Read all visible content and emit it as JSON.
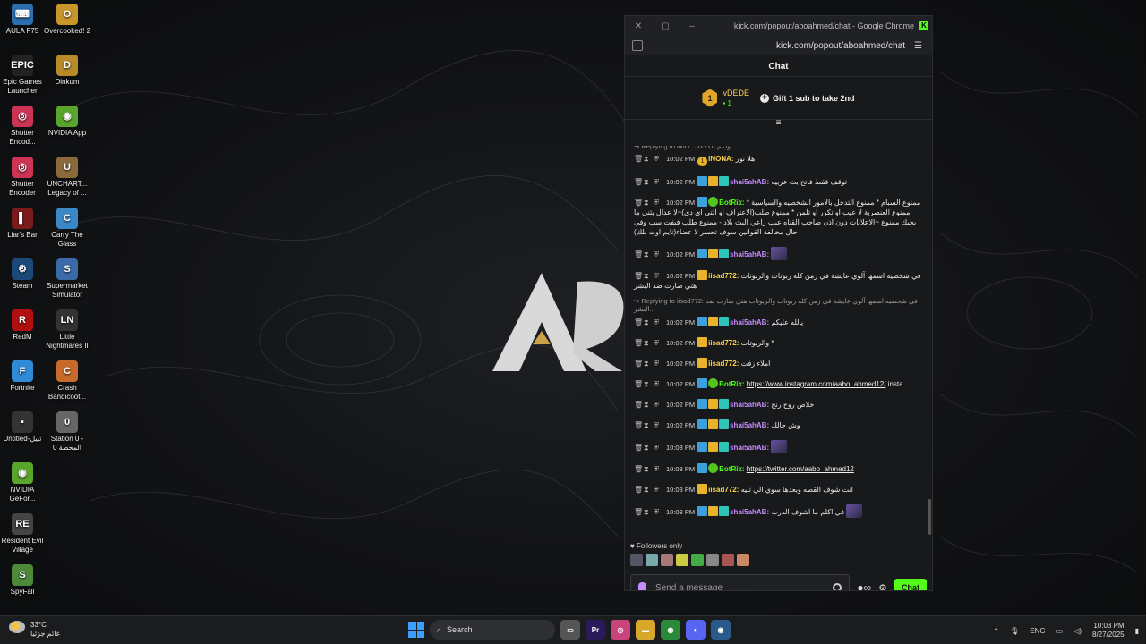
{
  "desktop": {
    "left_column": [
      {
        "label": "AULA F75",
        "color": "#2a6fb0",
        "glyph": "⌨"
      },
      {
        "label": "Epic Games Launcher",
        "color": "#222222",
        "glyph": "EPIC"
      },
      {
        "label": "Shutter Encod...",
        "color": "#cc3355",
        "glyph": "◎"
      },
      {
        "label": "Shutter Encoder",
        "color": "#cc3355",
        "glyph": "◎"
      },
      {
        "label": "Liar's Bar",
        "color": "#7a1a1a",
        "glyph": "▌"
      },
      {
        "label": "Steam",
        "color": "#1b4a7a",
        "glyph": "⚙"
      },
      {
        "label": "RedM",
        "color": "#b01010",
        "glyph": "R"
      },
      {
        "label": "Fortnite",
        "color": "#2f8ad8",
        "glyph": "F"
      },
      {
        "label": "Untitled-تبيل",
        "color": "#333333",
        "glyph": "▪"
      },
      {
        "label": "NVIDIA GeFor...",
        "color": "#5aa62c",
        "glyph": "◉"
      },
      {
        "label": "Resident Evil Village",
        "color": "#444444",
        "glyph": "RE"
      },
      {
        "label": "SpyFall",
        "color": "#4c8a3a",
        "glyph": "S"
      }
    ],
    "right_column": [
      {
        "label": "Overcooked! 2",
        "color": "#c8962a",
        "glyph": "O"
      },
      {
        "label": "Dinkum",
        "color": "#b88a2a",
        "glyph": "D"
      },
      {
        "label": "NVIDIA App",
        "color": "#5aa62c",
        "glyph": "◉"
      },
      {
        "label": "UNCHART... Legacy of ...",
        "color": "#8a6a3a",
        "glyph": "U"
      },
      {
        "label": "Carry The Glass",
        "color": "#3a88c8",
        "glyph": "C"
      },
      {
        "label": "Supermarket Simulator",
        "color": "#3a6aa8",
        "glyph": "S"
      },
      {
        "label": "Little Nightmares II",
        "color": "#333333",
        "glyph": "LN"
      },
      {
        "label": "Crash Bandicoot...",
        "color": "#c86a2a",
        "glyph": "C"
      },
      {
        "label": "Station 0 - المحطة 0",
        "color": "#666666",
        "glyph": "0"
      }
    ]
  },
  "window": {
    "title": "kick.com/popout/aboahmed/chat - Google Chrome",
    "address": "kick.com/popout/aboahmed/chat"
  },
  "chat": {
    "header": "Chat",
    "pinned": {
      "rank": "1",
      "gifter_name": "vDEDE",
      "gifter_count": "1",
      "gift_label": "Gift 1 sub to take 2nd"
    },
    "messages": [
      {
        "reply": "Replying to llklr7: ولكم بلكككك",
        "time": "10:02 PM",
        "badges": [],
        "rank": "1",
        "user": "INONA:",
        "color": "u-yellow",
        "text": "هلا نور"
      },
      {
        "reply": "",
        "time": "10:02 PM",
        "badges": [
          "blue",
          "gold",
          "teal"
        ],
        "user": "shai5ahAB:",
        "color": "u-purple",
        "text": "توقف فقط فاتح بث عربيه"
      },
      {
        "reply": "",
        "time": "10:02 PM",
        "badges": [
          "blue",
          "green"
        ],
        "user": "BotRix:",
        "color": "u-green",
        "text": "ممنوع السبام * ممنوع التدخل بالامور الشخصيه والسياسية * ممنوع العنصرية لا عيب او تكرر او تلمن * ممنوع طلب(الاعتراف او التي اي دي)~لا عدال بثني ما يجيك ممنوع ~الاعلانات دون اذن صاحب القناه عيب راعي البث بلاد - ممنوع طلب فيفت سب وفي حال مخالفة القوانين سوف تحسر لا عضاء(تايم اوت بلك)"
      },
      {
        "reply": "",
        "time": "10:02 PM",
        "badges": [
          "blue",
          "gold",
          "teal"
        ],
        "user": "shai5ahAB:",
        "color": "u-purple",
        "text": "",
        "emote": true
      },
      {
        "reply": "",
        "time": "10:02 PM",
        "badges": [
          "gold"
        ],
        "user": "iisad772:",
        "color": "u-yellow",
        "text": "في شخصيه اسمها آلوي عايشة في زمن كله ربوتات والربوتات هتي صارت ضد البشر"
      },
      {
        "reply": "Replying to iisad772: في شخصيه اسمها آلوي عايشة في زمن كله ربوتات والربوتات هتي صارت ضد البشر...",
        "time": "10:02 PM",
        "badges": [
          "blue",
          "gold",
          "teal"
        ],
        "user": "shai5ahAB:",
        "color": "u-purple",
        "text": "يالله عليكم"
      },
      {
        "reply": "",
        "time": "10:02 PM",
        "badges": [
          "gold"
        ],
        "user": "iisad772:",
        "color": "u-yellow",
        "text": "والربوتات *"
      },
      {
        "reply": "",
        "time": "10:02 PM",
        "badges": [
          "gold"
        ],
        "user": "iisad772:",
        "color": "u-yellow",
        "text": "املاء زفت"
      },
      {
        "reply": "",
        "time": "10:02 PM",
        "badges": [
          "blue",
          "green"
        ],
        "user": "BotRix:",
        "color": "u-green",
        "text": "insta",
        "link": "https://www.instagram.com/aabo_ahmed12/"
      },
      {
        "reply": "",
        "time": "10:02 PM",
        "badges": [
          "blue",
          "gold",
          "teal"
        ],
        "user": "shai5ahAB:",
        "color": "u-purple",
        "text": "خلاص روح رنج"
      },
      {
        "reply": "",
        "time": "10:02 PM",
        "badges": [
          "blue",
          "gold",
          "teal"
        ],
        "user": "shai5ahAB:",
        "color": "u-purple",
        "text": "وش حالك"
      },
      {
        "reply": "",
        "time": "10:03 PM",
        "badges": [
          "blue",
          "gold",
          "teal"
        ],
        "user": "shai5ahAB:",
        "color": "u-purple",
        "text": "",
        "emote": true
      },
      {
        "reply": "",
        "time": "10:03 PM",
        "badges": [
          "blue",
          "green"
        ],
        "user": "BotRix:",
        "color": "u-green",
        "text": "",
        "link": "https://twitter.com/aabo_ahmed12"
      },
      {
        "reply": "",
        "time": "10:03 PM",
        "badges": [
          "gold"
        ],
        "user": "iisad772:",
        "color": "u-yellow",
        "text": "انت شوف القصه وبعدها سوي الي تبيه"
      },
      {
        "reply": "",
        "time": "10:03 PM",
        "badges": [
          "blue",
          "gold",
          "teal"
        ],
        "user": "shai5ahAB:",
        "color": "u-purple",
        "text": "في اكلم ما اشوف الدرب",
        "emote": true
      }
    ],
    "followers_only": "Followers only",
    "input_placeholder": "Send a message",
    "send_label": "Chat"
  },
  "taskbar": {
    "temperature": "33°C",
    "weather_text": "غائم جزئيا",
    "search_label": "Search",
    "language": "ENG",
    "time": "10:03 PM",
    "date": "8/27/2025"
  }
}
